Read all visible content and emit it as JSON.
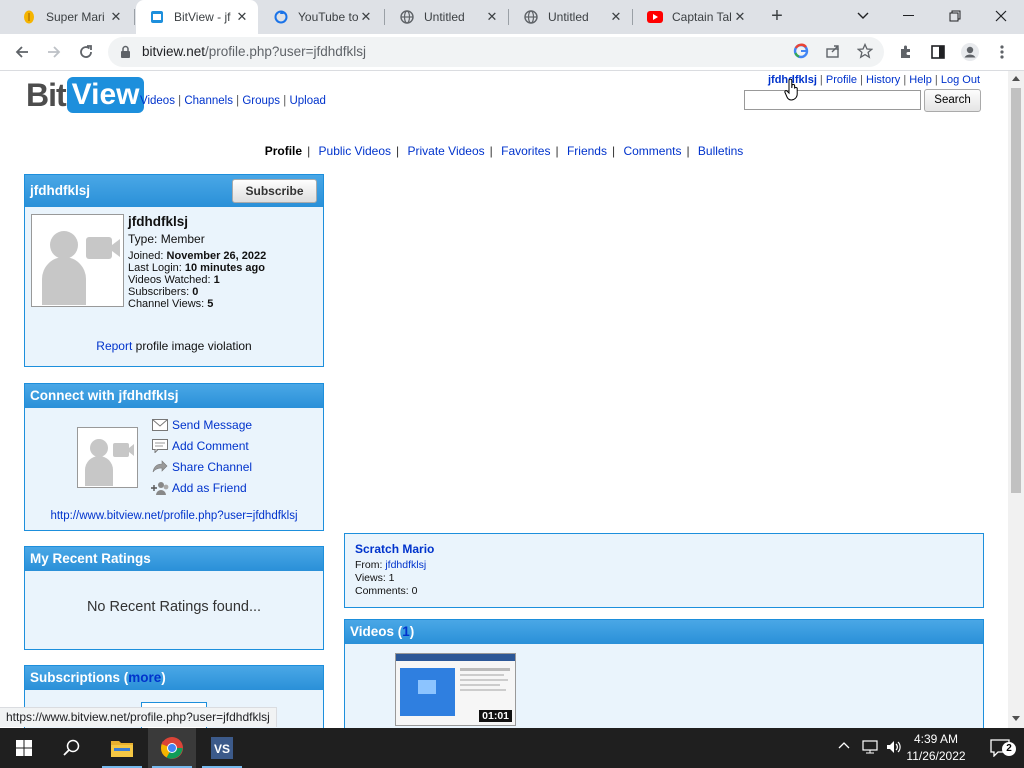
{
  "browser": {
    "tabs": [
      {
        "title": "Super Mari",
        "favicon": "coin-icon",
        "active": false
      },
      {
        "title": "BitView - jf",
        "favicon": "bitview-icon",
        "active": true
      },
      {
        "title": "YouTube to",
        "favicon": "sync-icon",
        "active": false
      },
      {
        "title": "Untitled",
        "favicon": "globe-icon",
        "active": false
      },
      {
        "title": "Untitled",
        "favicon": "globe-icon",
        "active": false
      },
      {
        "title": "Captain Tal",
        "favicon": "youtube-icon",
        "active": false
      }
    ],
    "url_host": "bitview.net",
    "url_path": "/profile.php?user=jfdhdfklsj",
    "status_url": "https://www.bitview.net/profile.php?user=jfdhdfklsj"
  },
  "site": {
    "logo_bit": "Bit",
    "logo_view": "View",
    "main_nav": [
      "Videos",
      "Channels",
      "Groups",
      "Upload"
    ],
    "user_nav": {
      "username": "jfdhdfklsj",
      "links": [
        "Profile",
        "History",
        "Help",
        "Log Out"
      ]
    },
    "search_button": "Search"
  },
  "profile_nav": {
    "current": "Profile",
    "links": [
      "Public Videos",
      "Private Videos",
      "Favorites",
      "Friends",
      "Comments",
      "Bulletins"
    ]
  },
  "profile_box": {
    "header": "jfdhdfklsj",
    "subscribe": "Subscribe",
    "name": "jfdhdfklsj",
    "type_label": "Type:",
    "type_value": "Member",
    "joined_label": "Joined:",
    "joined_value": "November 26, 2022",
    "last_login_label": "Last Login:",
    "last_login_value": "10 minutes ago",
    "videos_watched_label": "Videos Watched:",
    "videos_watched_value": "1",
    "subscribers_label": "Subscribers:",
    "subscribers_value": "0",
    "channel_views_label": "Channel Views:",
    "channel_views_value": "5",
    "report_link": "Report",
    "report_text": "profile image violation"
  },
  "connect_box": {
    "header": "Connect with jfdhdfklsj",
    "actions": [
      "Send Message",
      "Add Comment",
      "Share Channel",
      "Add as Friend"
    ],
    "profile_url": "http://www.bitview.net/profile.php?user=jfdhdfklsj"
  },
  "ratings_box": {
    "header": "My Recent Ratings",
    "empty": "No Recent Ratings found..."
  },
  "subscriptions_box": {
    "header": "Subscriptions (",
    "more": "more",
    "close": ")"
  },
  "featured": {
    "title": "Scratch Mario",
    "from_label": "From:",
    "from_user": "jfdhdfklsj",
    "views_label": "Views:",
    "views_value": "1",
    "comments_label": "Comments:",
    "comments_value": "0"
  },
  "videos_box": {
    "header": "Videos (",
    "count": "1",
    "close": ")",
    "thumb_duration": "01:01"
  },
  "taskbar": {
    "time": "4:39 AM",
    "date": "11/26/2022",
    "notifications": "2"
  },
  "colors": {
    "accent": "#1d8fdc",
    "link": "#0033cc",
    "box_bg": "#eaf4fc"
  }
}
